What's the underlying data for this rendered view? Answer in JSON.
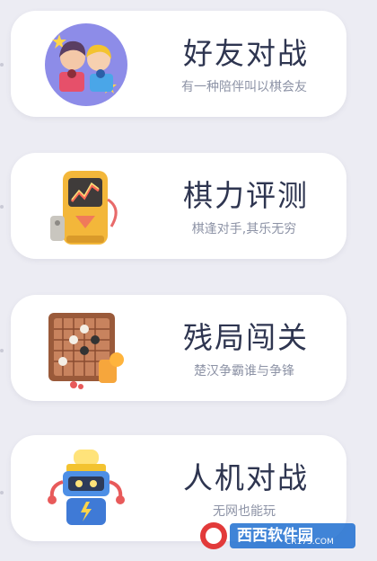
{
  "cards": [
    {
      "title": "好友对战",
      "subtitle": "有一种陪伴叫以棋会友",
      "icon": "friends-battle-icon"
    },
    {
      "title": "棋力评测",
      "subtitle": "棋逢对手,其乐无穷",
      "icon": "chess-skill-test-icon"
    },
    {
      "title": "残局闯关",
      "subtitle": "楚汉争霸谁与争锋",
      "icon": "endgame-challenge-icon"
    },
    {
      "title": "人机对战",
      "subtitle": "无网也能玩",
      "icon": "robot-battle-icon"
    }
  ],
  "watermark": {
    "brand": "西西软件园",
    "url": "CR173.COM"
  },
  "colors": {
    "background": "#ececf3",
    "card": "#ffffff",
    "title": "#2e3550",
    "subtitle": "#8d93a6"
  }
}
